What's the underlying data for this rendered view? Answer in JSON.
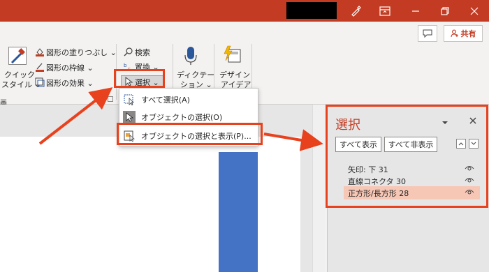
{
  "ribbon": {
    "quick_style_1": "クイック",
    "quick_style_2": "スタイル ⌄",
    "shape_fill": "図形の塗りつぶし ⌄",
    "shape_outline": "図形の枠線 ⌄",
    "shape_effects": "図形の効果 ⌄",
    "search": "検索",
    "replace": "置換 ⌄",
    "select": "選択 ⌄",
    "dictation_1": "ディクテー",
    "dictation_2": "ション ⌄",
    "design_1": "デザイン",
    "design_2": "アイデア",
    "group_label_fragment": "画"
  },
  "header": {
    "share": "共有"
  },
  "select_menu": {
    "items": [
      {
        "label": "すべて選択(A)",
        "icon": "select-all-icon"
      },
      {
        "label": "オブジェクトの選択(O)",
        "icon": "cursor-icon"
      },
      {
        "label": "オブジェクトの選択と表示(P)...",
        "icon": "selection-pane-icon"
      }
    ]
  },
  "selection_pane": {
    "title": "選択",
    "show_all": "すべて表示",
    "hide_all": "すべて非表示",
    "items": [
      {
        "name": "矢印: 下 31",
        "visible": true,
        "selected": false
      },
      {
        "name": "直線コネクタ 30",
        "visible": true,
        "selected": false
      },
      {
        "name": "正方形/長方形 28",
        "visible": true,
        "selected": true
      }
    ]
  },
  "colors": {
    "accent": "#c23b22",
    "highlight": "#e8411d",
    "selected_row": "#f7c7b6",
    "shape_fill": "#4472c4"
  }
}
